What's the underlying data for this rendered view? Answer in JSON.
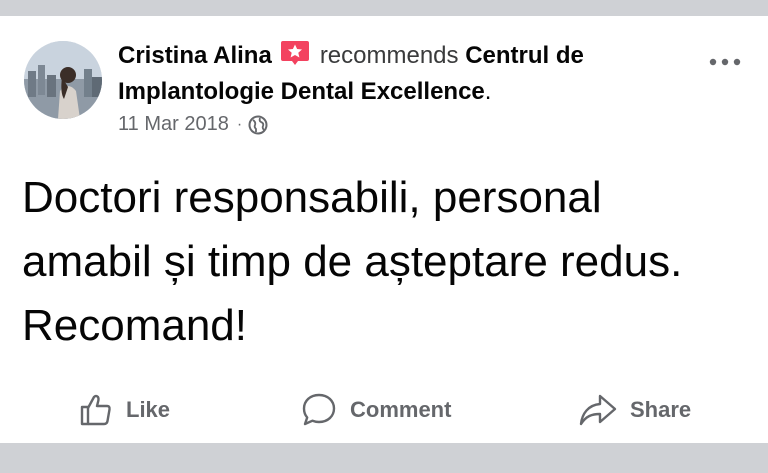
{
  "post": {
    "author": "Cristina Alina",
    "recommends_word": "recommends",
    "page_name": "Centrul de Implantologie Dental Excellence",
    "period": ".",
    "date": "11 Mar 2018",
    "separator": "·",
    "text": "Doctori responsabili, personal amabil și timp de așteptare redus. Recomand!"
  },
  "actions": {
    "like": "Like",
    "comment": "Comment",
    "share": "Share"
  },
  "icons": {
    "recommend": "star-badge-icon",
    "audience": "globe-icon",
    "more": "more-dots-icon",
    "like": "thumbs-up-icon",
    "comment": "comment-bubble-icon",
    "share": "share-arrow-icon"
  },
  "colors": {
    "recommend_badge": "#f3425f",
    "secondary_text": "#65676b",
    "divider": "#cfd1d5"
  }
}
